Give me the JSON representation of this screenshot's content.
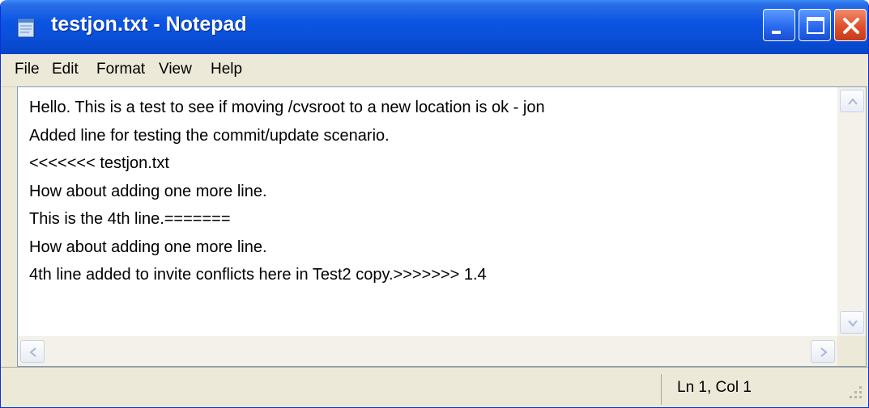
{
  "window": {
    "title": "testjon.txt - Notepad"
  },
  "menu": {
    "items": [
      "File",
      "Edit",
      "Format",
      "View",
      "Help"
    ]
  },
  "document": {
    "lines": [
      "Hello. This is a test to see if moving /cvsroot to a new location is ok - jon",
      "Added line for testing the commit/update scenario.",
      "<<<<<<< testjon.txt",
      "How about adding one more line.",
      "This is the 4th line.=======",
      "How about adding one more line.",
      "4th line added to invite conflicts here in Test2 copy.>>>>>>> 1.4"
    ]
  },
  "status": {
    "position": "Ln 1, Col 1"
  },
  "icons": {
    "app": "notepad-icon",
    "minimize": "minimize-icon",
    "maximize": "maximize-icon",
    "close": "close-icon",
    "scroll_up": "arrow-up-icon",
    "scroll_down": "arrow-down-icon",
    "scroll_left": "arrow-left-icon",
    "scroll_right": "arrow-right-icon",
    "grip": "resize-grip-icon"
  },
  "colors": {
    "titlebar": "#0b55e3",
    "close_button": "#e0502c",
    "chrome": "#ece9d8"
  }
}
